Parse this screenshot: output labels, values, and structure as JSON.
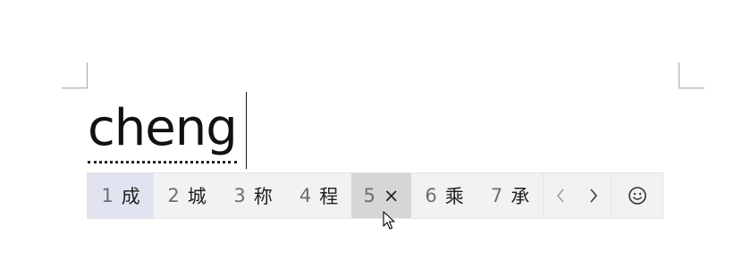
{
  "document": {
    "composition_text": "cheng"
  },
  "ime": {
    "candidates": [
      {
        "number": "1",
        "text": "成",
        "state": "selected"
      },
      {
        "number": "2",
        "text": "城",
        "state": "normal"
      },
      {
        "number": "3",
        "text": "称",
        "state": "normal"
      },
      {
        "number": "4",
        "text": "程",
        "state": "normal"
      },
      {
        "number": "5",
        "text": "×",
        "state": "hovered"
      },
      {
        "number": "6",
        "text": "乘",
        "state": "normal"
      },
      {
        "number": "7",
        "text": "承",
        "state": "normal"
      }
    ],
    "prev_page_glyph": "‹",
    "next_page_glyph": "›",
    "emoji_icon": "smiley-icon",
    "colors": {
      "selected_bg": "#e1e3f0",
      "hover_bg": "#d6d6d6",
      "bar_bg": "#f2f2f2"
    }
  }
}
